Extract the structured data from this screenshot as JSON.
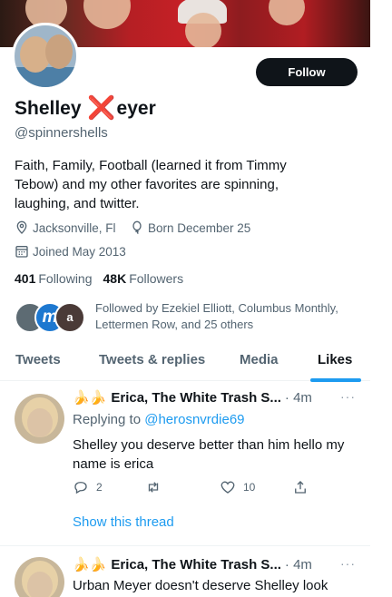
{
  "profile": {
    "display_name_before": "Shelley ",
    "display_name_x": "❌",
    "display_name_after": "eyer",
    "handle": "@spinnershells",
    "follow_label": "Follow",
    "bio": "Faith, Family, Football (learned it from Timmy Tebow) and my other favorites are spinning, laughing, and twitter.",
    "location": "Jacksonville, Fl",
    "born": "Born December 25",
    "joined": "Joined May 2013",
    "following_count": "401",
    "following_label": "Following",
    "followers_count": "48K",
    "followers_label": "Followers",
    "followed_by": "Followed by Ezekiel Elliott, Columbus Monthly, Lettermen Row, and 25 others",
    "followed_avatar_2": "m",
    "followed_avatar_3": "a"
  },
  "tabs": [
    {
      "label": "Tweets"
    },
    {
      "label": "Tweets & replies"
    },
    {
      "label": "Media"
    },
    {
      "label": "Likes"
    }
  ],
  "active_tab": "Likes",
  "tweets": [
    {
      "emoji": "🍌🍌",
      "author": "Erica, The White Trash S...",
      "time": "· 4m",
      "more": "···",
      "replying_prefix": "Replying to ",
      "replying_handle": "@herosnvrdie69",
      "text": "Shelley you deserve better than him hello my name is erica",
      "reply_count": "2",
      "retweet_count": "",
      "like_count": "10",
      "show_thread": "Show this thread"
    },
    {
      "emoji": "🍌🍌",
      "author": "Erica, The White Trash S...",
      "time": "· 4m",
      "more": "···",
      "text": "Urban Meyer doesn't deserve Shelley look"
    }
  ],
  "colors": {
    "accent": "#1d9bf0",
    "text_primary": "#0f1419",
    "text_secondary": "#536471",
    "follow_button": "#0f1419",
    "x_mark": "#e0241e"
  },
  "icons": {
    "location": "location-pin-icon",
    "born": "balloon-icon",
    "joined": "calendar-icon",
    "reply": "reply-icon",
    "retweet": "retweet-icon",
    "like": "heart-icon",
    "share": "share-icon",
    "more": "more-icon"
  }
}
